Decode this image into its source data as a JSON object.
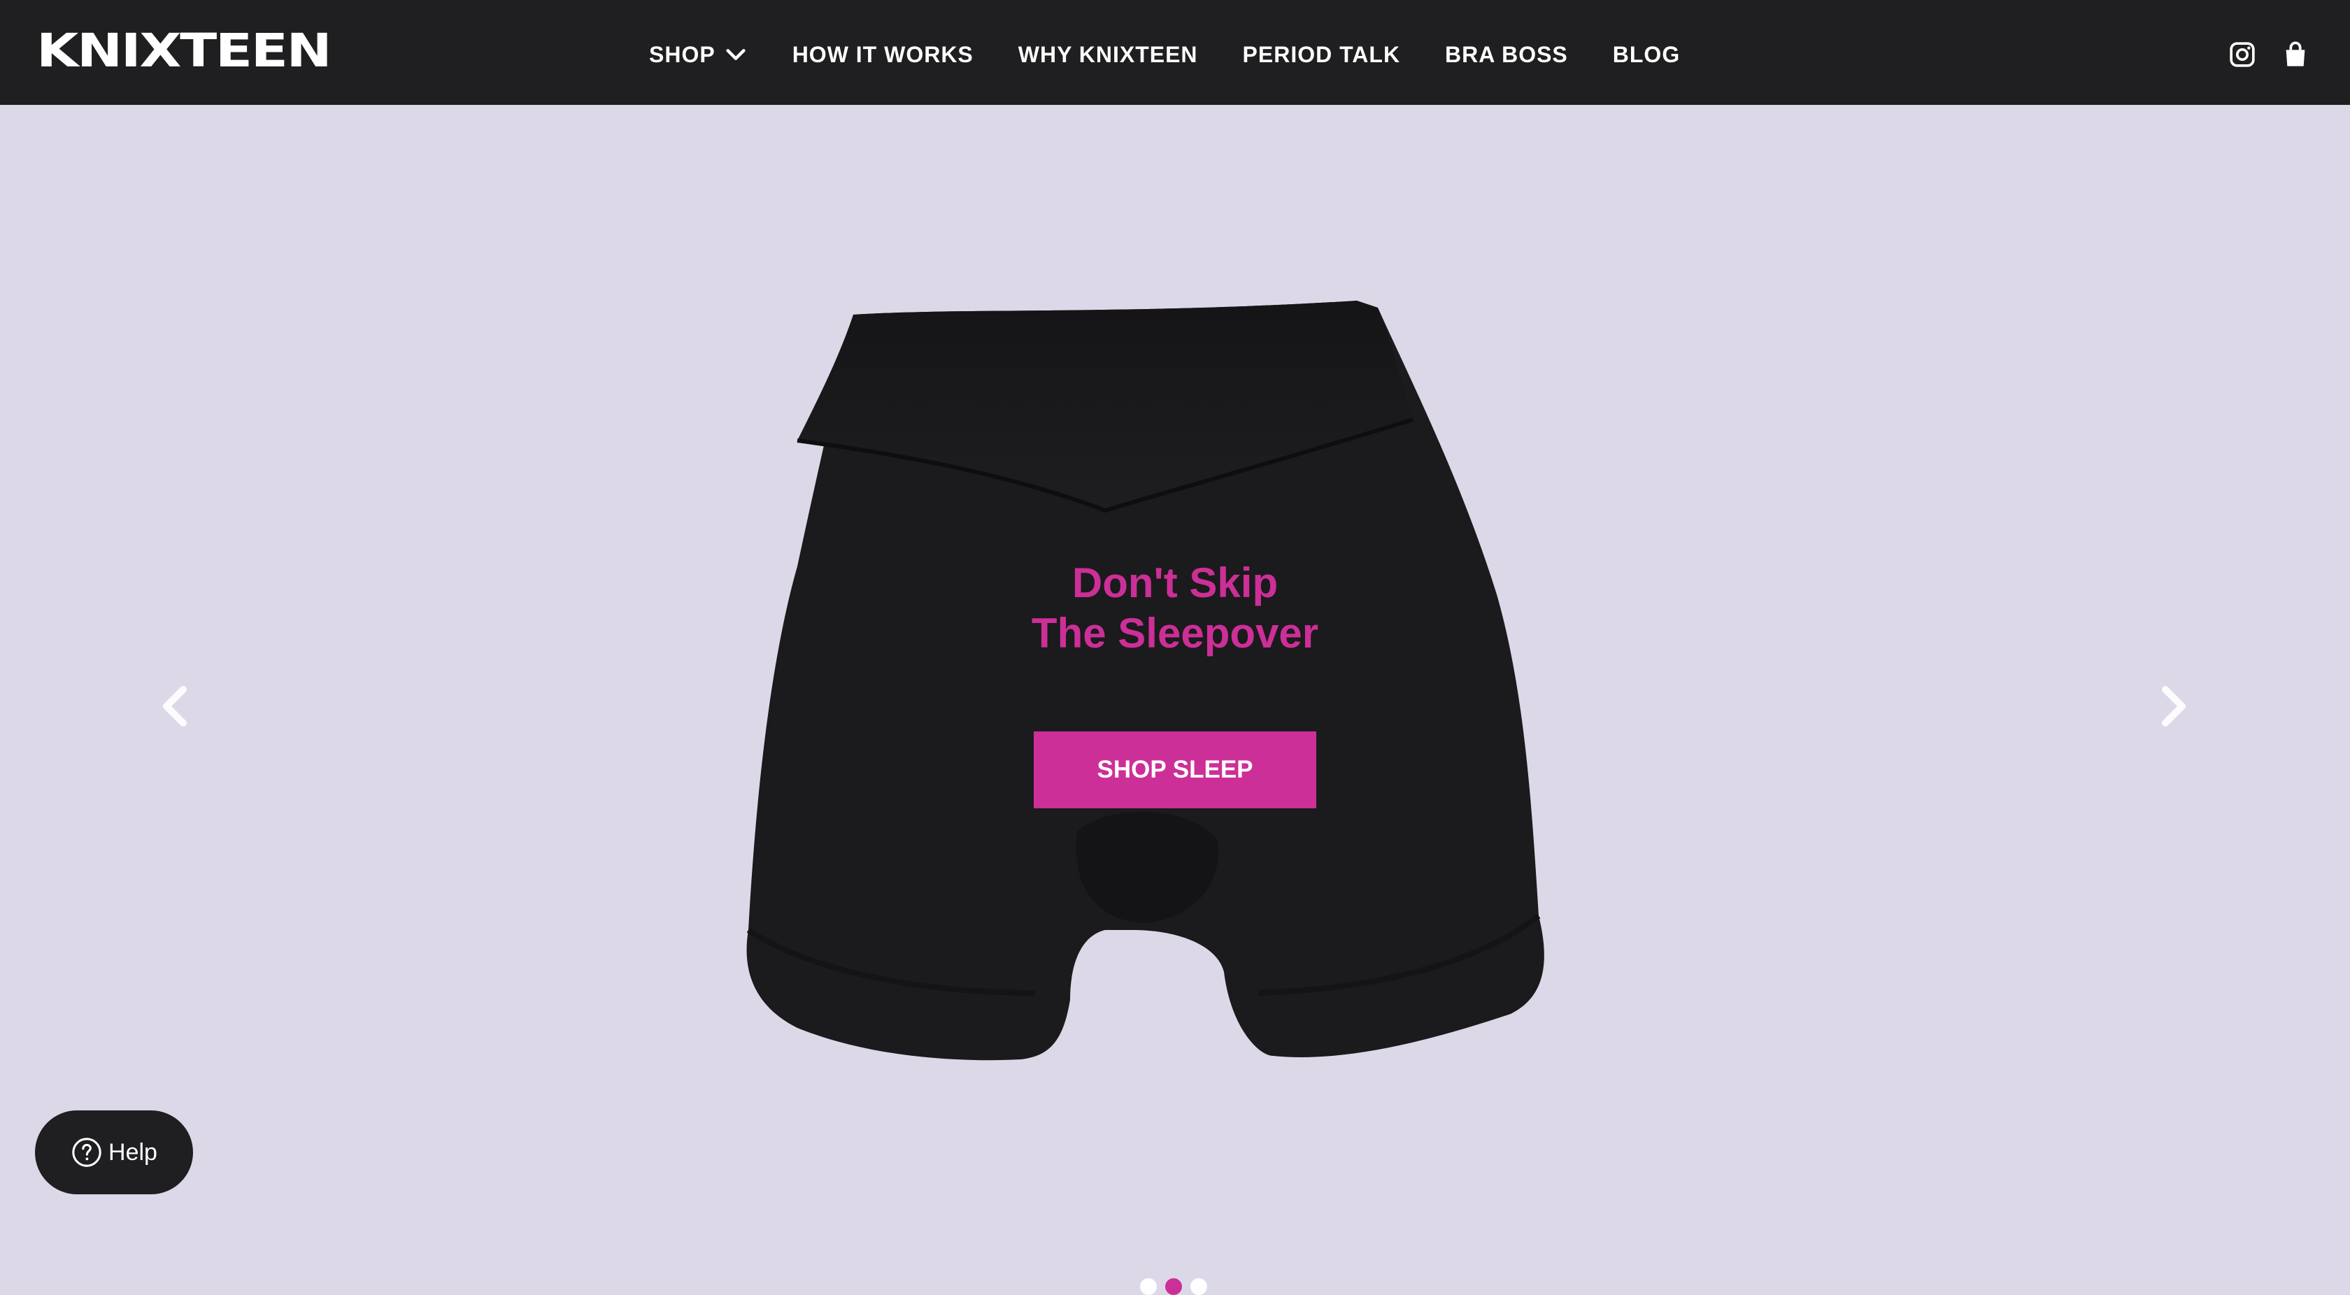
{
  "header": {
    "logo": "KNIXTEEN",
    "nav": [
      {
        "label": "SHOP",
        "has_dropdown": true
      },
      {
        "label": "HOW IT WORKS"
      },
      {
        "label": "WHY KNIXTEEN"
      },
      {
        "label": "PERIOD TALK"
      },
      {
        "label": "BRA BOSS"
      },
      {
        "label": "BLOG"
      }
    ],
    "icons": [
      "instagram-icon",
      "shopping-bag-icon"
    ]
  },
  "hero": {
    "headline_line1": "Don't Skip",
    "headline_line2": "The Sleepover",
    "cta_label": "SHOP SLEEP",
    "carousel": {
      "total_slides": 3,
      "active_slide": 2
    }
  },
  "help": {
    "label": "Help"
  },
  "colors": {
    "header_bg": "#1f1e20",
    "page_bg": "#dcd8e8",
    "accent": "#cc2f97",
    "product": "#1b1a1c"
  }
}
